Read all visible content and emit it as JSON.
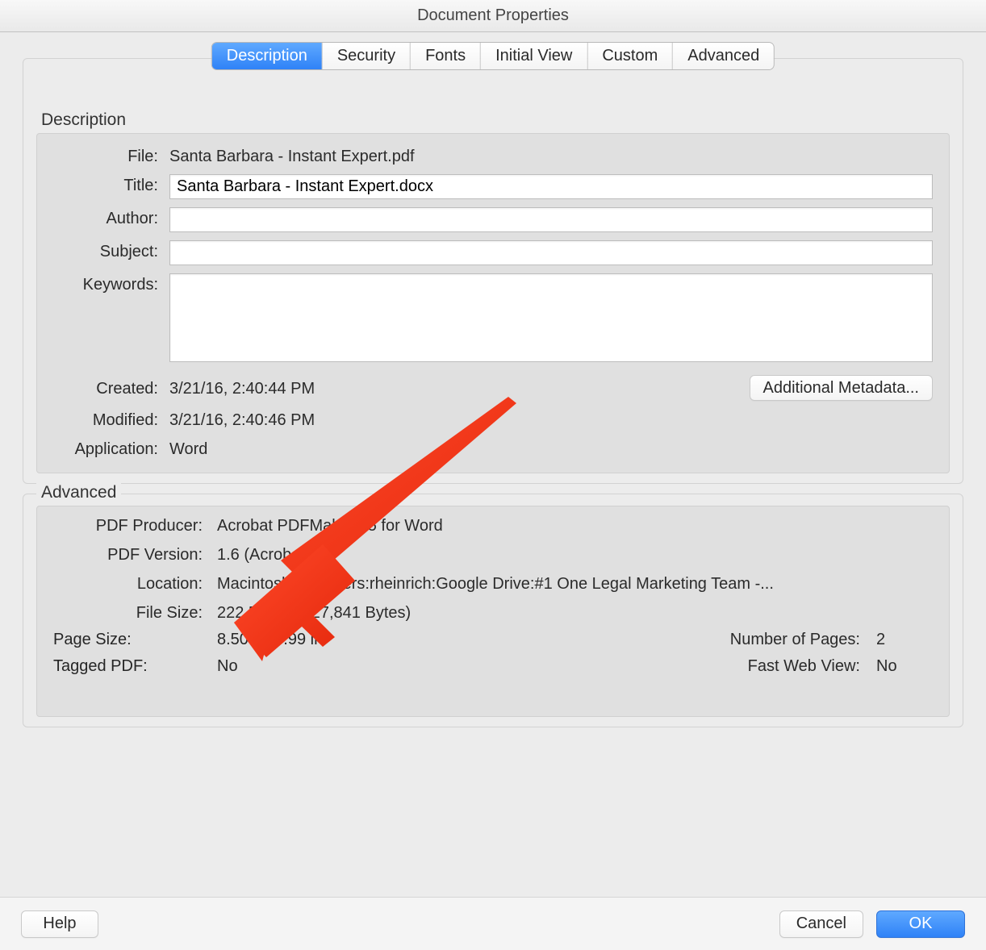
{
  "window": {
    "title": "Document Properties"
  },
  "tabs": {
    "description": "Description",
    "security": "Security",
    "fonts": "Fonts",
    "initial_view": "Initial View",
    "custom": "Custom",
    "advanced": "Advanced"
  },
  "description_section": {
    "legend": "Description",
    "labels": {
      "file": "File:",
      "title": "Title:",
      "author": "Author:",
      "subject": "Subject:",
      "keywords": "Keywords:",
      "created": "Created:",
      "modified": "Modified:",
      "application": "Application:"
    },
    "values": {
      "file": "Santa Barbara - Instant Expert.pdf",
      "title": "Santa Barbara - Instant Expert.docx",
      "author": "",
      "subject": "",
      "keywords": "",
      "created": "3/21/16, 2:40:44 PM",
      "modified": "3/21/16, 2:40:46 PM",
      "application": "Word"
    },
    "additional_metadata_btn": "Additional Metadata..."
  },
  "advanced_section": {
    "legend": "Advanced",
    "labels": {
      "pdf_producer": "PDF Producer:",
      "pdf_version": "PDF Version:",
      "location": "Location:",
      "file_size": "File Size:",
      "page_size": "Page Size:",
      "number_of_pages": "Number of Pages:",
      "tagged_pdf": "Tagged PDF:",
      "fast_web_view": "Fast Web View:"
    },
    "values": {
      "pdf_producer": "Acrobat PDFMaker 15 for Word",
      "pdf_version": "1.6 (Acrobat 7.x)",
      "location": "Macintosh HD:Users:rheinrich:Google Drive:#1 One Legal Marketing Team -...",
      "file_size": "222.50 KB (227,841 Bytes)",
      "page_size": "8.50 x 10.99 in",
      "number_of_pages": "2",
      "tagged_pdf": "No",
      "fast_web_view": "No"
    }
  },
  "buttons": {
    "help": "Help",
    "cancel": "Cancel",
    "ok": "OK"
  }
}
